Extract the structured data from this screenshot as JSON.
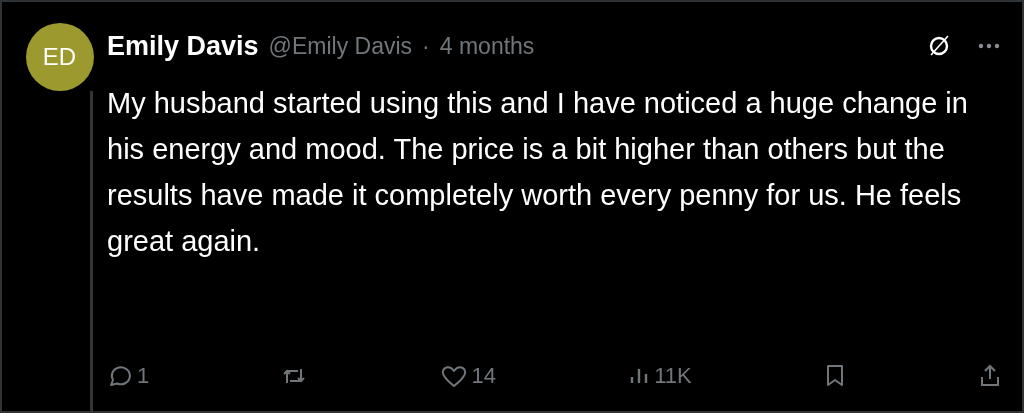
{
  "post": {
    "avatar_initials": "ED",
    "author": "Emily Davis",
    "handle": "@Emily Davis",
    "separator": "·",
    "time": "4 months",
    "text": "My husband started using this and I have noticed a huge change in his energy and mood. The price is a bit higher than others but the results have made it completely worth every penny for us. He feels great again.",
    "actions": [
      {
        "kind": "reply",
        "count": "1"
      },
      {
        "kind": "repost"
      },
      {
        "kind": "like",
        "count": "14"
      },
      {
        "kind": "views",
        "count": "11K"
      },
      {
        "kind": "bookmark"
      },
      {
        "kind": "share"
      }
    ]
  }
}
